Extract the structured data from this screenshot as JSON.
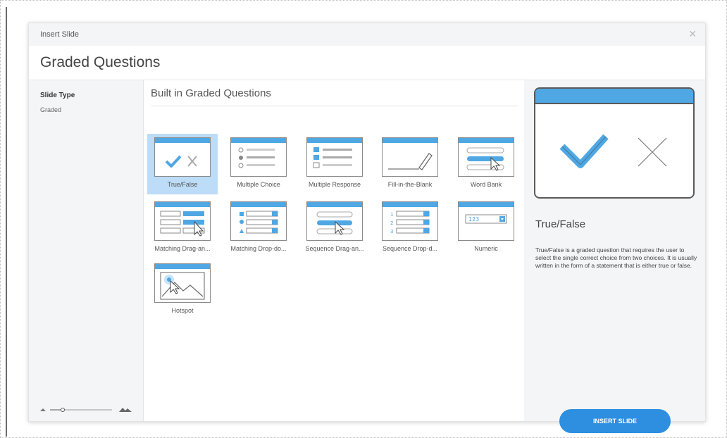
{
  "dialog": {
    "title": "Insert Slide",
    "close_icon": "close-icon",
    "heading": "Graded Questions"
  },
  "sidebar": {
    "slide_type_label": "Slide Type",
    "slide_type_value": "Graded"
  },
  "zoom": {
    "small_icon": "mountain-small-icon",
    "large_icon": "mountain-large-icon"
  },
  "gallery": {
    "section_title": "Built in Graded Questions",
    "selected": "True/False",
    "tiles": [
      {
        "label": "True/False",
        "icon": "true-false-icon"
      },
      {
        "label": "Multiple Choice",
        "icon": "multiple-choice-icon"
      },
      {
        "label": "Multiple Response",
        "icon": "multiple-response-icon"
      },
      {
        "label": "Fill-in-the-Blank",
        "icon": "fill-in-blank-icon"
      },
      {
        "label": "Word Bank",
        "icon": "word-bank-icon"
      },
      {
        "label": "Matching  Drag-an...",
        "icon": "matching-drag-icon"
      },
      {
        "label": "Matching  Drop-do...",
        "icon": "matching-dropdown-icon"
      },
      {
        "label": "Sequence  Drag-an...",
        "icon": "sequence-drag-icon"
      },
      {
        "label": "Sequence  Drop-d...",
        "icon": "sequence-dropdown-icon"
      },
      {
        "label": "Numeric",
        "icon": "numeric-icon",
        "thumb_text": "123"
      },
      {
        "label": "Hotspot",
        "icon": "hotspot-icon"
      }
    ]
  },
  "preview": {
    "title": "True/False",
    "description": "True/False is a graded question that requires the user to select the single correct choice from two choices. It is usually written in the form of a statement that is either true or false.",
    "button_label": "INSERT SLIDE"
  },
  "colors": {
    "accent": "#4fa7e3",
    "button": "#2e8ee0",
    "selected_tile": "#bcdcf7",
    "panel_bg": "#f4f5f7"
  }
}
